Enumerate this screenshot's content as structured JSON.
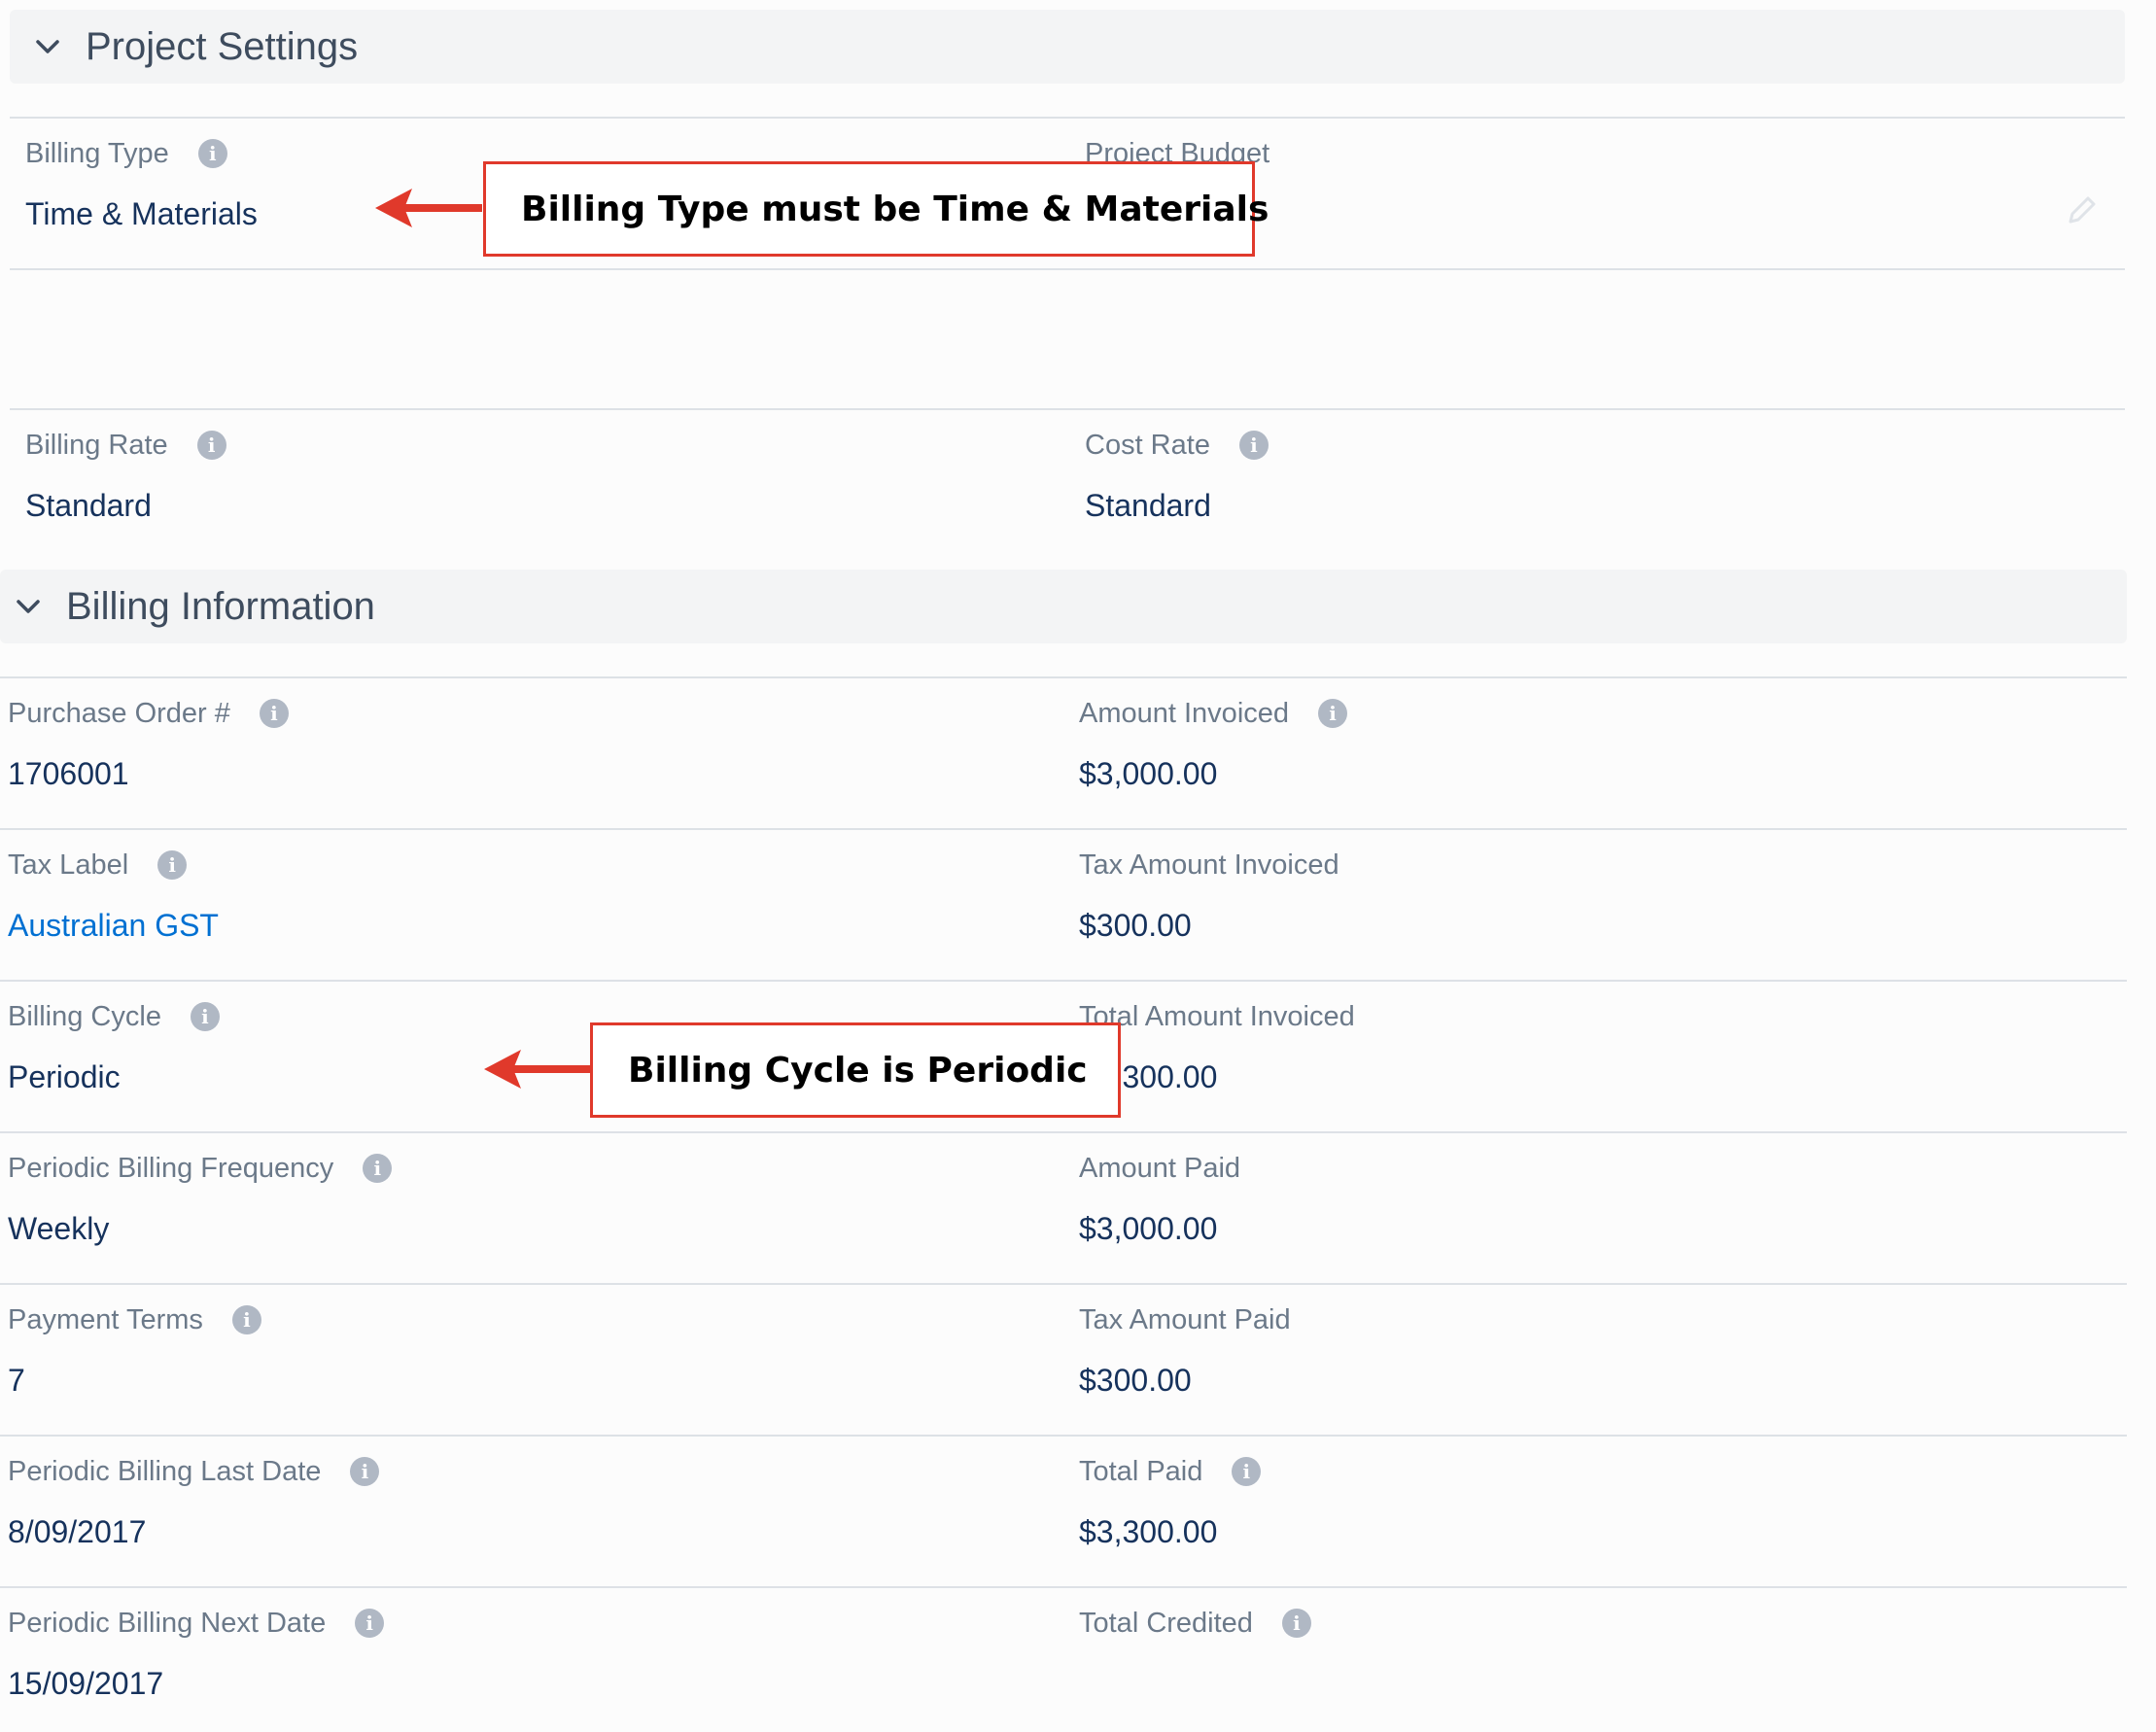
{
  "project_settings": {
    "title": "Project Settings",
    "billing_type": {
      "label": "Billing Type",
      "value": "Time & Materials"
    },
    "project_budget": {
      "label": "Project Budget",
      "value": ""
    },
    "billing_rate": {
      "label": "Billing Rate",
      "value": "Standard"
    },
    "cost_rate": {
      "label": "Cost Rate",
      "value": "Standard"
    }
  },
  "billing_information": {
    "title": "Billing Information",
    "left_fields": [
      {
        "label": "Purchase Order #",
        "value": "1706001"
      },
      {
        "label": "Tax Label",
        "value": "Australian GST"
      },
      {
        "label": "Billing Cycle",
        "value": "Periodic"
      },
      {
        "label": "Periodic Billing Frequency",
        "value": "Weekly"
      },
      {
        "label": "Payment Terms",
        "value": "7"
      },
      {
        "label": "Periodic Billing Last Date",
        "value": "8/09/2017"
      },
      {
        "label": "Periodic Billing Next Date",
        "value": "15/09/2017"
      }
    ],
    "right_fields": [
      {
        "label": "Amount Invoiced",
        "value": "$3,000.00"
      },
      {
        "label": "Tax Amount Invoiced",
        "value": "$300.00"
      },
      {
        "label": "Total Amount Invoiced",
        "value": "$3,300.00"
      },
      {
        "label": "Amount Paid",
        "value": "$3,000.00"
      },
      {
        "label": "Tax Amount Paid",
        "value": "$300.00"
      },
      {
        "label": "Total Paid",
        "value": "$3,300.00"
      },
      {
        "label": "Total Credited",
        "value": ""
      }
    ]
  },
  "annotations": {
    "billing_type_note": "Billing Type must be Time & Materials",
    "billing_cycle_note": "Billing Cycle is Periodic"
  },
  "icons": {
    "info": "info-icon",
    "chevron": "chevron-down-icon",
    "edit": "pencil-icon",
    "arrow": "arrow-left-icon"
  },
  "colors": {
    "link": "#0070d2",
    "callout_border": "#e0392b",
    "header_bg": "#f3f4f5"
  }
}
